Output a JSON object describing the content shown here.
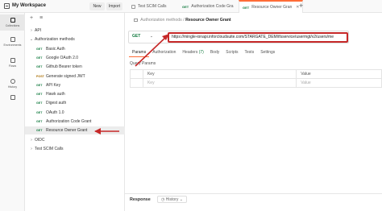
{
  "header": {
    "workspace_title": "My Workspace",
    "new_label": "New",
    "import_label": "Import"
  },
  "tabs": [
    {
      "method": "",
      "label": "Test SCIM Calls"
    },
    {
      "method": "GET",
      "label": "Authorization Code Gra"
    },
    {
      "method": "GET",
      "label": "Resource Owner Gran"
    }
  ],
  "rail": [
    {
      "label": "Collections",
      "icon": "collections-icon"
    },
    {
      "label": "Environments",
      "icon": "environments-icon"
    },
    {
      "label": "Flows",
      "icon": "flows-icon"
    },
    {
      "label": "History",
      "icon": "history-icon"
    },
    {
      "label": "",
      "icon": "configure-icon"
    }
  ],
  "sidebar": {
    "tree": [
      {
        "indent": 0,
        "chev": "›",
        "method": "",
        "label": "API"
      },
      {
        "indent": 0,
        "chev": "⌄",
        "method": "",
        "label": "Authorization methods"
      },
      {
        "indent": 1,
        "chev": "",
        "method": "GET",
        "label": "Basic Auth"
      },
      {
        "indent": 1,
        "chev": "",
        "method": "GET",
        "label": "Google OAuth 2.0"
      },
      {
        "indent": 1,
        "chev": "",
        "method": "GET",
        "label": "Github Bearer token"
      },
      {
        "indent": 1,
        "chev": "",
        "method": "POST",
        "label": "Generate signed JWT"
      },
      {
        "indent": 1,
        "chev": "",
        "method": "GET",
        "label": "API Key"
      },
      {
        "indent": 1,
        "chev": "",
        "method": "GET",
        "label": "Hawk auth"
      },
      {
        "indent": 1,
        "chev": "",
        "method": "GET",
        "label": "Digest auth"
      },
      {
        "indent": 1,
        "chev": "",
        "method": "GET",
        "label": "OAuth 1.0"
      },
      {
        "indent": 1,
        "chev": "",
        "method": "GET",
        "label": "Authorization Code Grant"
      },
      {
        "indent": 1,
        "chev": "",
        "method": "GET",
        "label": "Resource Owner Grant",
        "selected": true
      },
      {
        "indent": 0,
        "chev": "›",
        "method": "",
        "label": "OIDC"
      },
      {
        "indent": 0,
        "chev": "›",
        "method": "",
        "label": "Test SCIM Calls"
      }
    ]
  },
  "breadcrumb": {
    "parent": "Authorization methods",
    "separator": "/",
    "current": "Resource Owner Grant"
  },
  "request": {
    "method": "GET",
    "url": "https://mingle-ionapi.inforcloudsuite.com/STARGATE_DEM/ifsservice/usermgt/v2/users/me"
  },
  "request_tabs": [
    {
      "label": "Params",
      "count": "",
      "active": true
    },
    {
      "label": "Authorization",
      "count": ""
    },
    {
      "label": "Headers",
      "count": "(7)"
    },
    {
      "label": "Body",
      "count": ""
    },
    {
      "label": "Scripts",
      "count": ""
    },
    {
      "label": "Tests",
      "count": ""
    },
    {
      "label": "Settings",
      "count": ""
    }
  ],
  "query_params": {
    "title": "Query Params",
    "headers": [
      "Key",
      "Value"
    ],
    "placeholders": [
      "Key",
      "Value"
    ]
  },
  "response": {
    "label": "Response",
    "history_label": "History"
  },
  "colors": {
    "accent": "#ff6c37",
    "get": "#117a3e",
    "post": "#a86c00",
    "highlight": "#c62828"
  }
}
